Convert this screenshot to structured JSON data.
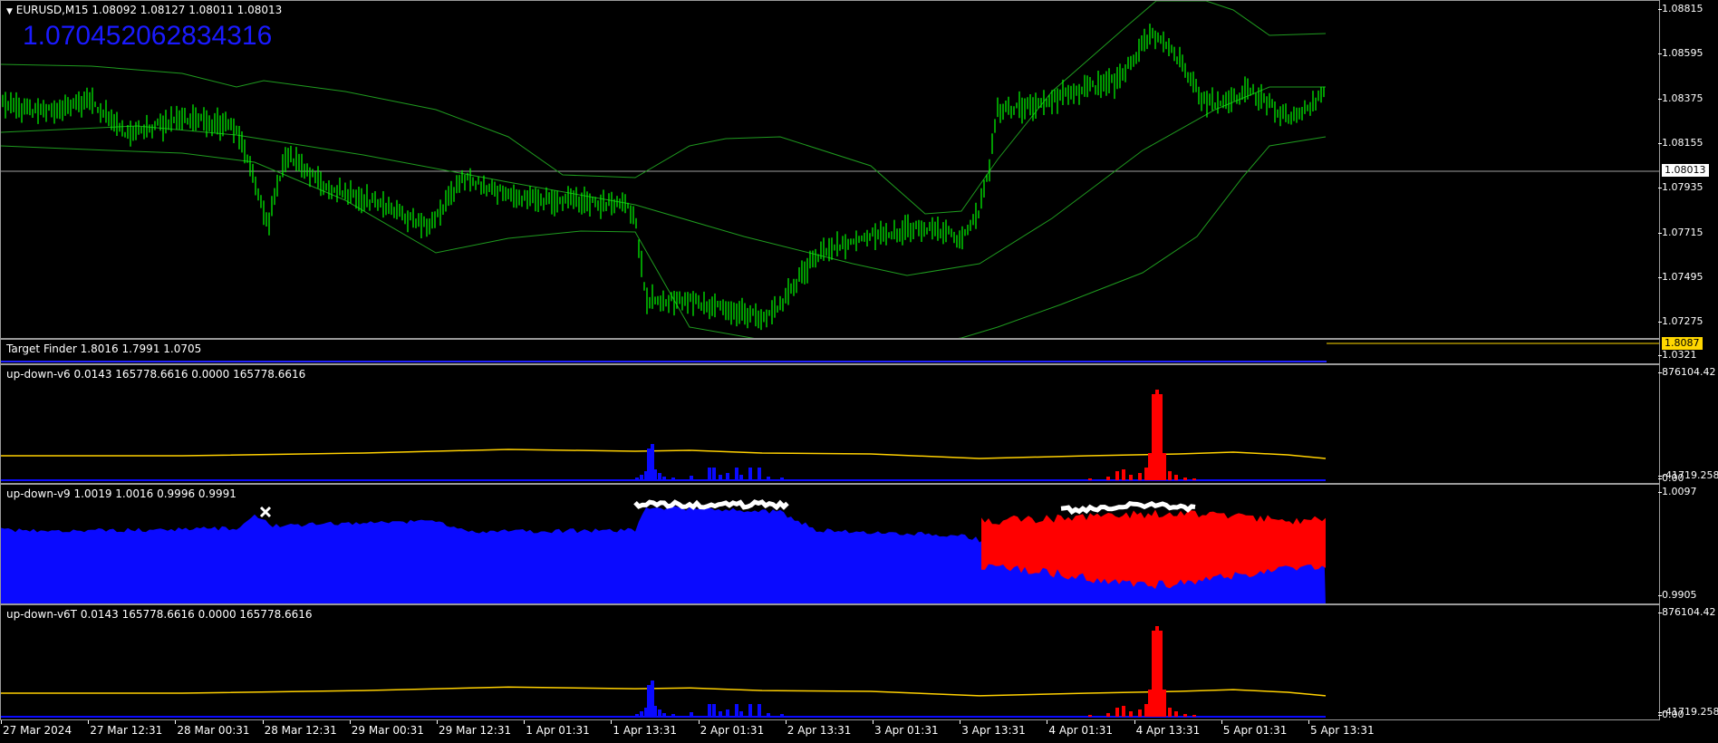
{
  "main": {
    "title": "EURUSD,M15  1.08092 1.08127 1.08011 1.08013",
    "big_value": "1.070452062834316",
    "price_ticks": [
      "1.08815",
      "1.08595",
      "1.08375",
      "1.08155",
      "1.07935",
      "1.07715",
      "1.07495",
      "1.07275"
    ],
    "current_price": "1.08013",
    "colors": {
      "candles": "#00ff00",
      "bands": "#1f9b1f",
      "price_line": "#a0a0a0"
    }
  },
  "target_finder": {
    "title": "Target Finder 1.8016 1.7991 1.0705",
    "value_box": "1.8087",
    "tick": "1.0321",
    "colors": {
      "box": "#ffd700",
      "line": "#2222ff"
    }
  },
  "updown_v6": {
    "title": "up-down-v6 0.0143 165778.6616 0.0000 165778.6616",
    "top_tick": "876104.42",
    "bottom_tick": "0.00",
    "bottom_tick_overlay": "-41719.258"
  },
  "updown_v9": {
    "title": "up-down-v9 1.0019 1.0016 0.9996 0.9991",
    "top_tick": "1.0097",
    "bottom_tick": "0.9905"
  },
  "updown_v6t": {
    "title": "up-down-v6T 0.0143 165778.6616 0.0000 165778.6616",
    "top_tick": "876104.42",
    "bottom_tick": "0.00",
    "bottom_tick_overlay": "-41719.258"
  },
  "time_axis": [
    "27 Mar 2024",
    "27 Mar 12:31",
    "28 Mar 00:31",
    "28 Mar 12:31",
    "29 Mar 00:31",
    "29 Mar 12:31",
    "1 Apr 01:31",
    "1 Apr 13:31",
    "2 Apr 01:31",
    "2 Apr 13:31",
    "3 Apr 01:31",
    "3 Apr 13:31",
    "4 Apr 01:31",
    "4 Apr 13:31",
    "5 Apr 01:31",
    "5 Apr 13:31"
  ],
  "colors": {
    "blue": "#0a0aff",
    "red": "#ff0000",
    "yellow": "#ffd000",
    "white": "#ffffff"
  }
}
